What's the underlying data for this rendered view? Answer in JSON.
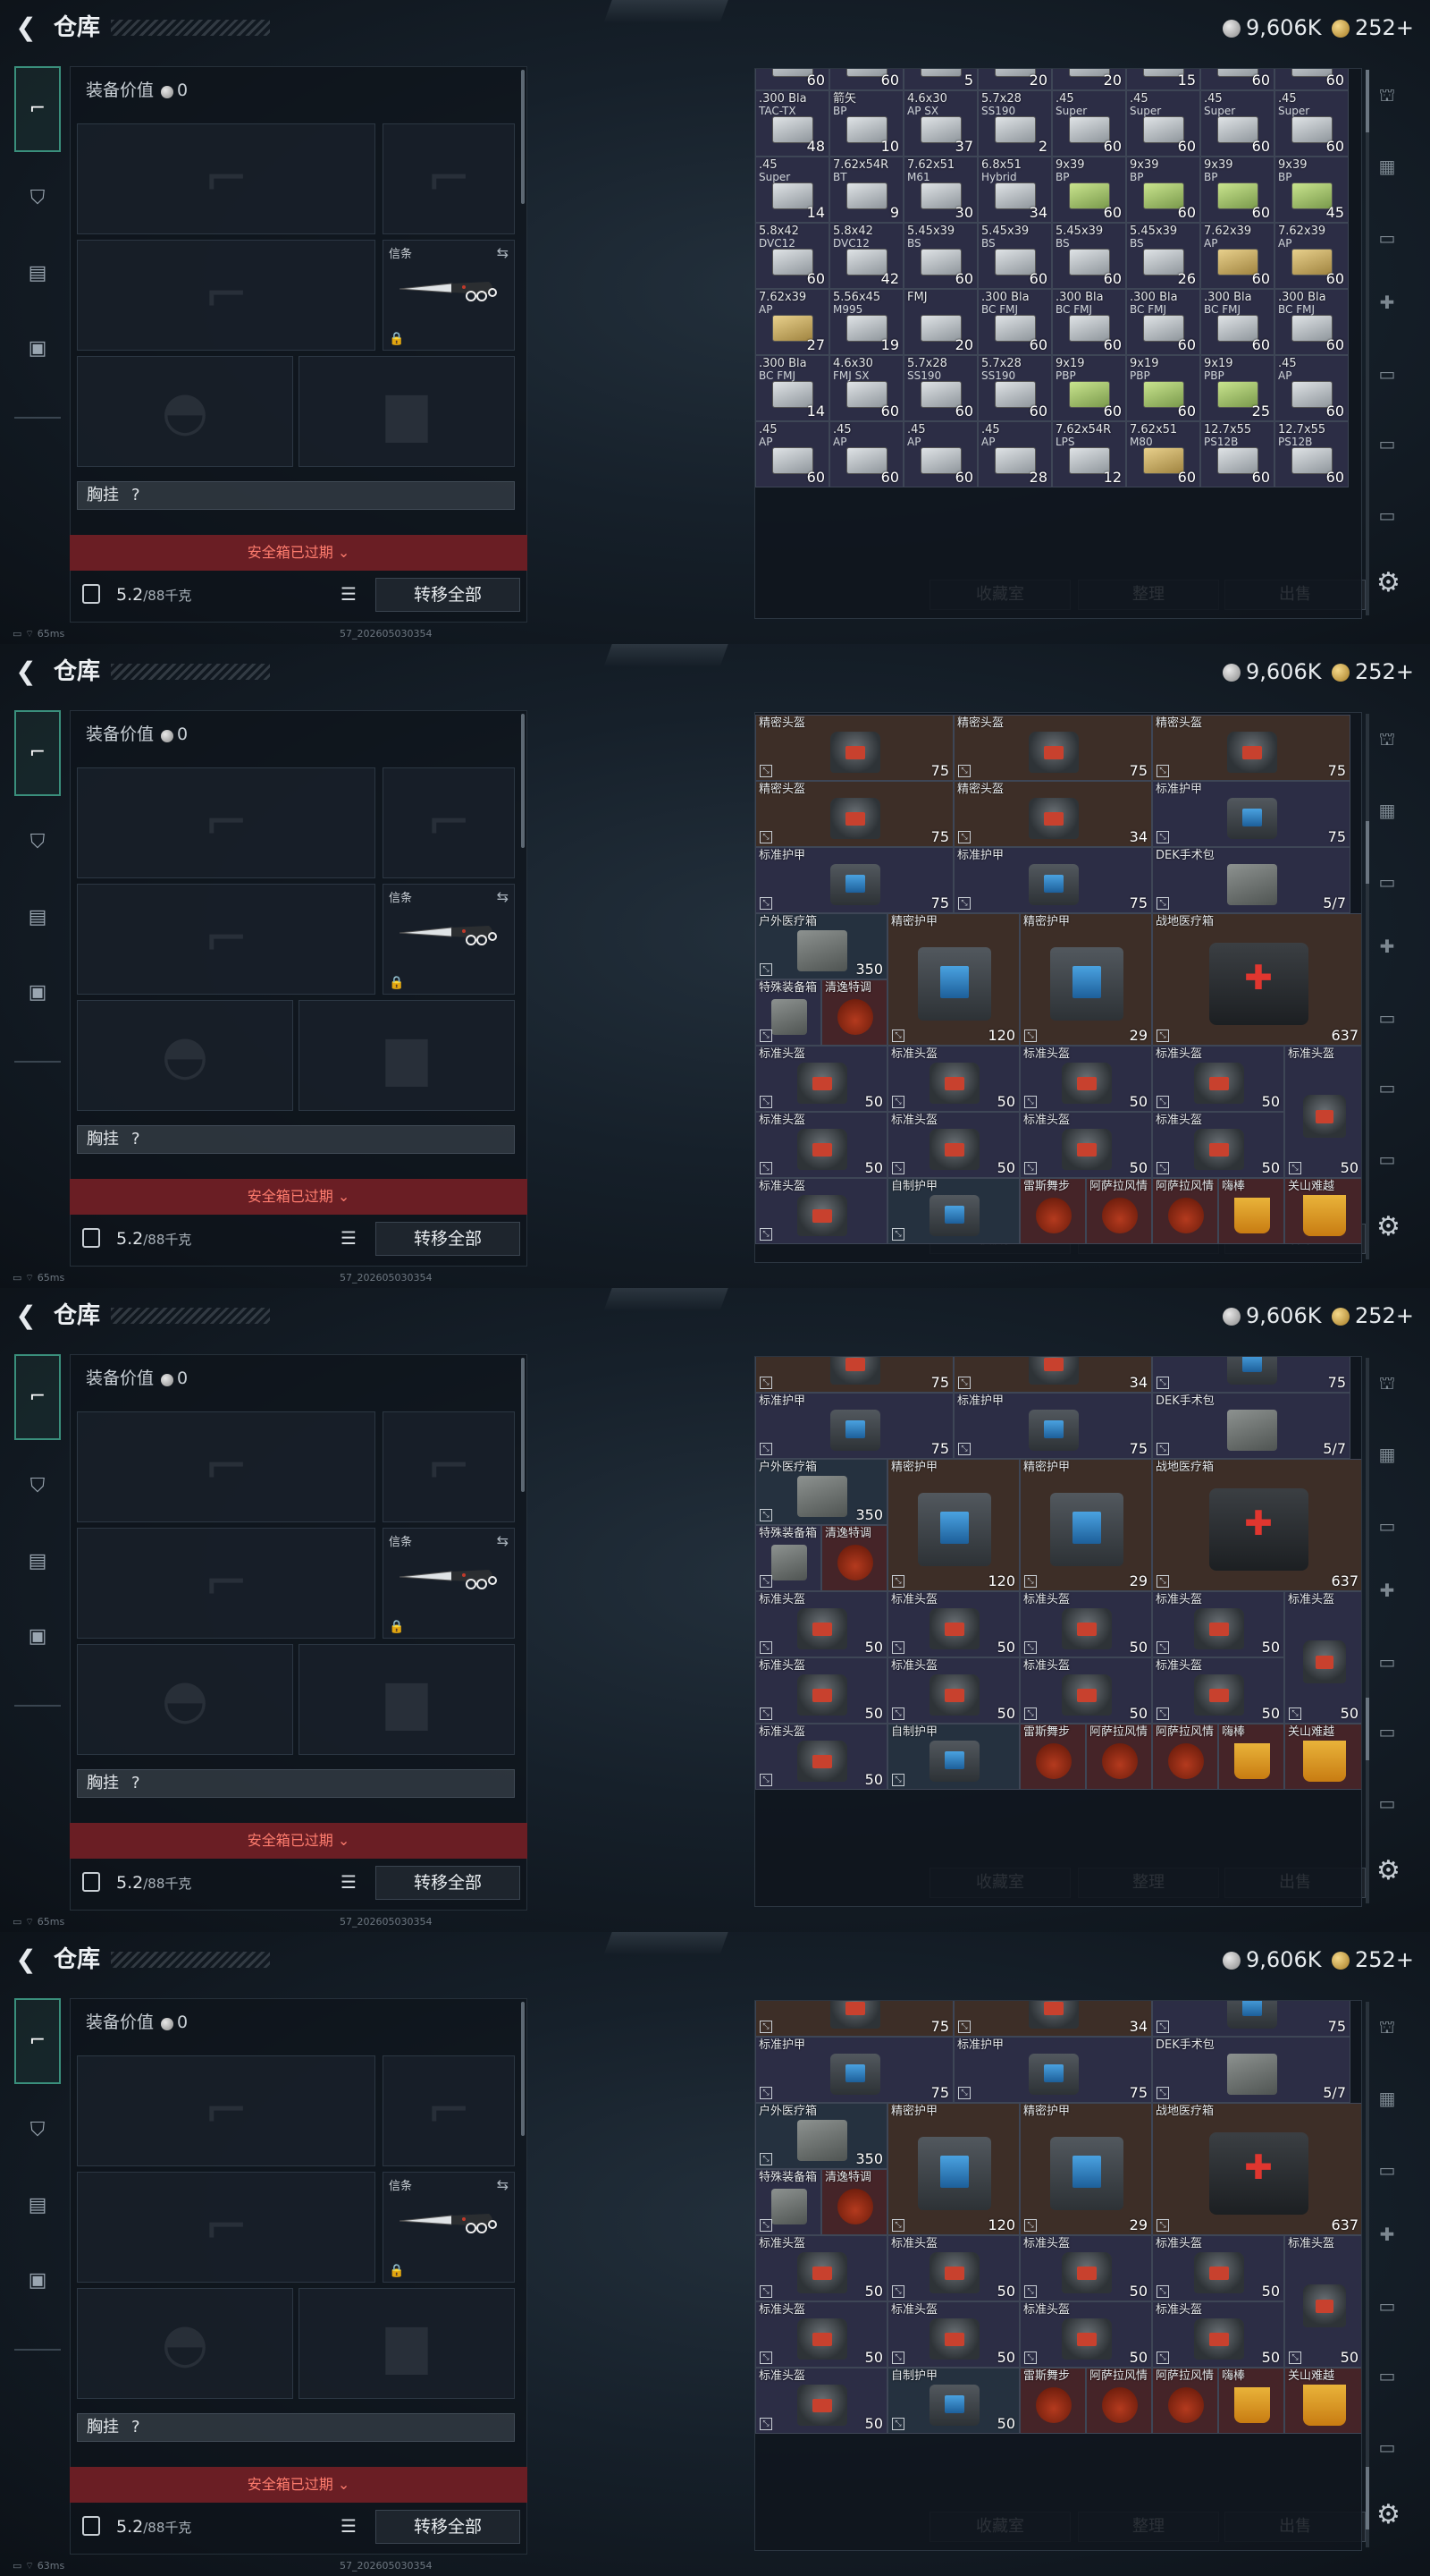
{
  "header": {
    "back_icon": "back-arrow-icon",
    "title": "仓库",
    "silver": "9,606K",
    "gold": "252",
    "gold_plus": "+"
  },
  "equip": {
    "value_label": "装备价值",
    "value": "0",
    "knife_label": "信条",
    "chest_label": "胸挂",
    "chest_q": "?",
    "expired": "安全箱已过期",
    "weight": "5.2",
    "weight_cap": "/88千克",
    "transfer": "转移全部"
  },
  "buttons": {
    "collection": "收藏室",
    "sort": "整理",
    "sell": "出售"
  },
  "status": {
    "ping": "65ms",
    "build": "57_202605030354"
  },
  "frame1_ammo": [
    [
      "",
      "",
      "60",
      ""
    ],
    [
      "",
      "",
      "60",
      ""
    ],
    [
      "",
      "",
      "5",
      ""
    ],
    [
      "",
      "",
      "20",
      ""
    ],
    [
      "",
      "",
      "20",
      ""
    ],
    [
      "",
      "",
      "15",
      ""
    ],
    [
      "",
      "",
      "60",
      ""
    ],
    [
      "",
      "",
      "60",
      ""
    ],
    [
      ".300 Bla",
      "TAC-TX",
      "48",
      "w"
    ],
    [
      "箭矢",
      "BP",
      "10",
      "w"
    ],
    [
      "4.6x30",
      "AP SX",
      "37",
      "w"
    ],
    [
      "5.7x28",
      "SS190",
      "2",
      "w"
    ],
    [
      ".45",
      "Super",
      "60",
      "w"
    ],
    [
      ".45",
      "Super",
      "60",
      "w"
    ],
    [
      ".45",
      "Super",
      "60",
      "w"
    ],
    [
      ".45",
      "Super",
      "60",
      "w"
    ],
    [
      ".45",
      "Super",
      "14",
      "w"
    ],
    [
      "7.62x54R",
      "BT",
      "9",
      "w"
    ],
    [
      "7.62x51",
      "M61",
      "30",
      "w"
    ],
    [
      "6.8x51",
      "Hybrid",
      "34",
      "w"
    ],
    [
      "9x39",
      "BP",
      "60",
      "g"
    ],
    [
      "9x39",
      "BP",
      "60",
      "g"
    ],
    [
      "9x39",
      "BP",
      "60",
      "g"
    ],
    [
      "9x39",
      "BP",
      "45",
      "g"
    ],
    [
      "5.8x42",
      "DVC12",
      "60",
      "w"
    ],
    [
      "5.8x42",
      "DVC12",
      "42",
      "w"
    ],
    [
      "5.45x39",
      "BS",
      "60",
      "w"
    ],
    [
      "5.45x39",
      "BS",
      "60",
      "w"
    ],
    [
      "5.45x39",
      "BS",
      "60",
      "w"
    ],
    [
      "5.45x39",
      "BS",
      "26",
      "w"
    ],
    [
      "7.62x39",
      "AP",
      "60",
      "y"
    ],
    [
      "7.62x39",
      "AP",
      "60",
      "y"
    ],
    [
      "7.62x39",
      "AP",
      "27",
      "y"
    ],
    [
      "5.56x45",
      "M995",
      "19",
      "w"
    ],
    [
      "FMJ",
      "",
      "20",
      "w"
    ],
    [
      ".300 Bla",
      "BC FMJ",
      "60",
      "w"
    ],
    [
      ".300 Bla",
      "BC FMJ",
      "60",
      "w"
    ],
    [
      ".300 Bla",
      "BC FMJ",
      "60",
      "w"
    ],
    [
      ".300 Bla",
      "BC FMJ",
      "60",
      "w"
    ],
    [
      ".300 Bla",
      "BC FMJ",
      "60",
      "w"
    ],
    [
      ".300 Bla",
      "BC FMJ",
      "14",
      "w"
    ],
    [
      "4.6x30",
      "FMJ SX",
      "60",
      "w"
    ],
    [
      "5.7x28",
      "SS190",
      "60",
      "w"
    ],
    [
      "5.7x28",
      "SS190",
      "60",
      "w"
    ],
    [
      "9x19",
      "PBP",
      "60",
      "g"
    ],
    [
      "9x19",
      "PBP",
      "60",
      "g"
    ],
    [
      "9x19",
      "PBP",
      "25",
      "g"
    ],
    [
      ".45",
      "AP",
      "60",
      "w"
    ],
    [
      ".45",
      "AP",
      "60",
      "w"
    ],
    [
      ".45",
      "AP",
      "60",
      "w"
    ],
    [
      ".45",
      "AP",
      "60",
      "w"
    ],
    [
      ".45",
      "AP",
      "28",
      "w"
    ],
    [
      "7.62x54R",
      "LPS",
      "12",
      "w"
    ],
    [
      "7.62x51",
      "M80",
      "60",
      "y"
    ],
    [
      "12.7x55",
      "PS12B",
      "60",
      "w"
    ],
    [
      "12.7x55",
      "PS12B",
      "60",
      "w"
    ]
  ],
  "gear_cells": {
    "f2": [
      {
        "n": "精密头盔",
        "q": "75",
        "c": "brown",
        "t": "helmet",
        "r": 0,
        "c0": 0,
        "w": 3,
        "h": 1,
        "bind": true
      },
      {
        "n": "精密头盔",
        "q": "75",
        "c": "brown",
        "t": "helmet",
        "r": 0,
        "c0": 3,
        "w": 3,
        "h": 1,
        "bind": true
      },
      {
        "n": "精密头盔",
        "q": "75",
        "c": "brown",
        "t": "helmet",
        "r": 0,
        "c0": 6,
        "w": 3,
        "h": 1,
        "bind": true
      },
      {
        "n": "精密头盔",
        "q": "75",
        "c": "brown",
        "t": "helmet",
        "r": 1,
        "c0": 0,
        "w": 3,
        "h": 1
      },
      {
        "n": "精密头盔",
        "q": "34",
        "c": "brown",
        "t": "helmet",
        "r": 1,
        "c0": 3,
        "w": 3,
        "h": 1
      },
      {
        "n": "标准护甲",
        "q": "75",
        "c": "purple",
        "t": "armor",
        "r": 1,
        "c0": 6,
        "w": 3,
        "h": 1
      },
      {
        "n": "标准护甲",
        "q": "75",
        "c": "purple",
        "t": "armor",
        "r": 2,
        "c0": 0,
        "w": 3,
        "h": 1
      },
      {
        "n": "标准护甲",
        "q": "75",
        "c": "purple",
        "t": "armor",
        "r": 2,
        "c0": 3,
        "w": 3,
        "h": 1
      },
      {
        "n": "DEK手术包",
        "q": "5/7",
        "c": "purple",
        "t": "case",
        "r": 2,
        "c0": 6,
        "w": 3,
        "h": 1
      }
    ]
  },
  "labels": {
    "precise_helmet": "精密头盔",
    "std_armor": "标准护甲",
    "dek": "DEK手术包",
    "outdoor_med": "户外医疗箱",
    "precise_armor": "精密护甲",
    "field_med": "战地医疗箱",
    "special_case": "特殊装备箱",
    "cleanse": "清逸特调",
    "std_helmet": "标准头盔",
    "homemade_armor": "自制护甲",
    "thunder": "雷斯舞步",
    "asala": "阿萨拉风情",
    "hi": "嗨棒",
    "guanshan": "关山难越",
    "q75": "75",
    "q34": "34",
    "q57": "5/7",
    "q350": "350",
    "q120": "120",
    "q29": "29",
    "q637": "637",
    "q50": "50"
  }
}
